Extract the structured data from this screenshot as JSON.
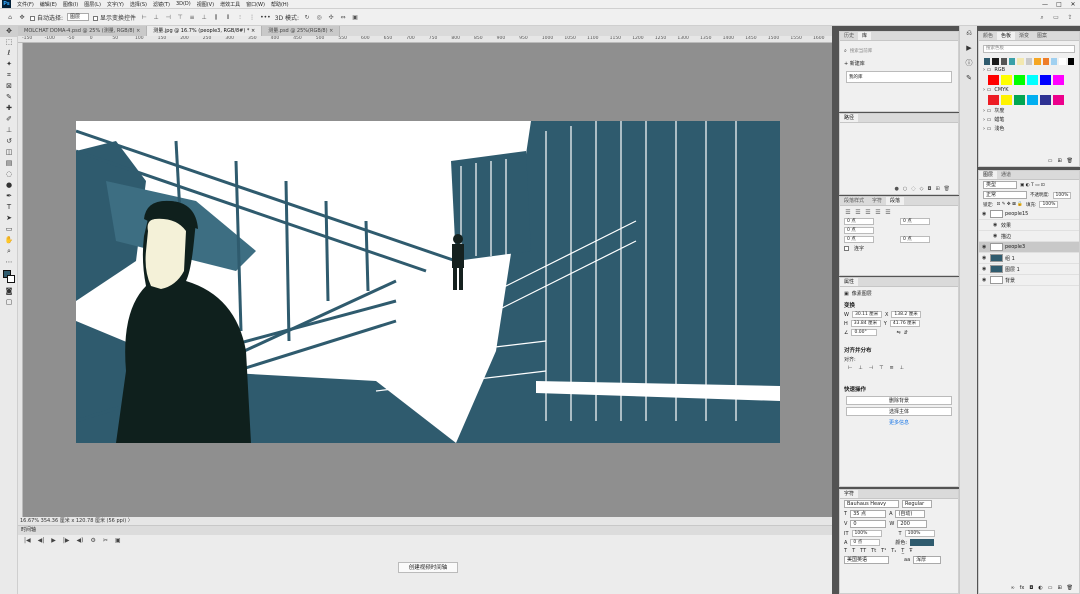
{
  "menubar": {
    "logo": "Ps",
    "items": [
      "文件(F)",
      "编辑(E)",
      "图像(I)",
      "图层(L)",
      "文字(Y)",
      "选择(S)",
      "滤镜(T)",
      "3D(D)",
      "视图(V)",
      "增效工具",
      "窗口(W)",
      "帮助(H)"
    ],
    "window_controls": [
      "—",
      "□",
      "✕"
    ]
  },
  "options_bar": {
    "auto_select_label": "自动选择:",
    "auto_select_value": "图层",
    "show_transform_label": "显示变换控件",
    "more": "•••",
    "mode_3d": "3D 模式:"
  },
  "tabs": [
    {
      "label": "MOLCHAT DOMA-4.psd @ 25% (测量, RGB/8) ×",
      "active": false
    },
    {
      "label": "测量.jpg @ 16.7% (people3, RGB/8#) * ×",
      "active": true
    },
    {
      "label": "测量.psd @ 25%(RGB/8) ×",
      "active": false
    }
  ],
  "ruler_ticks": [
    "-150",
    "-100",
    "-50",
    "0",
    "50",
    "100",
    "150",
    "200",
    "250",
    "300",
    "350",
    "400",
    "450",
    "500",
    "550",
    "600",
    "650",
    "700",
    "750",
    "800",
    "850",
    "900",
    "950",
    "1000",
    "1050",
    "1100",
    "1150",
    "1200",
    "1250",
    "1300",
    "1350",
    "1400",
    "1450",
    "1500",
    "1550",
    "1600"
  ],
  "status": "16.67%   354.36 厘米 x 120.78 厘米 (56 ppi)   〉",
  "timeline": {
    "title": "时间轴",
    "create_button": "创建视频时间轴",
    "controls": [
      "|◀",
      "◀|",
      "▶",
      "|▶",
      "◀)",
      "⚙",
      "✂",
      "▣"
    ]
  },
  "history_panel": {
    "tabs": [
      "历史",
      "库"
    ],
    "search_placeholder": "搜索当前库",
    "create_new": "+ 新建库",
    "library_item": "我的库"
  },
  "paths_panel": {
    "title": "路径"
  },
  "paragraph_panel": {
    "tabs": [
      "段落样式",
      "字符",
      "段落"
    ],
    "fields": [
      {
        "label": "缩进左",
        "value": "0 点"
      },
      {
        "label": "缩进右",
        "value": "0 点"
      },
      {
        "label": "首行缩进",
        "value": "0 点"
      },
      {
        "label": "段前",
        "value": "0 点"
      },
      {
        "label": "段后",
        "value": "0 点"
      }
    ],
    "hyphenate_label": "连字"
  },
  "properties_panel": {
    "title": "属性",
    "layer_type": "像素图层",
    "transform_title": "变换",
    "w_label": "W",
    "w_value": "30.11 厘米",
    "h_label": "H",
    "h_value": "33.84 厘米",
    "x_label": "X",
    "x_value": "138.2 厘米",
    "y_label": "Y",
    "y_value": "41.76 厘米",
    "angle_value": "0.00°",
    "align_title": "对齐并分布",
    "align_label": "对齐:",
    "quick_actions_title": "快速操作",
    "qa_buttons": [
      "删除背景",
      "选择主体"
    ],
    "more_link": "更多信息"
  },
  "character_panel": {
    "title": "字符",
    "font_family": "Bauhaus Heavy",
    "font_style": "Regular",
    "size": "35 点",
    "leading": "(自动)",
    "tracking": "0",
    "kerning": "200",
    "vscale": "100%",
    "hscale": "100%",
    "baseline": "0 点",
    "color_label": "颜色:",
    "color_value": "#2f5b6e",
    "language": "美国英语",
    "aa": "浑厚"
  },
  "swatches_panel": {
    "tabs": [
      "颜色",
      "色板",
      "渐变",
      "图案"
    ],
    "search_placeholder": "搜索色板",
    "recent": [
      "#2f5b6e",
      "#1a1a1a",
      "#555555",
      "#3aa0a8",
      "#f3e8b0",
      "#c9c9c9",
      "#f5a623",
      "#ee7d2a",
      "#a0d0f0",
      "#fff",
      "#000"
    ],
    "groups": [
      {
        "name": "RGB",
        "colors": [
          "#ff0000",
          "#ffff00",
          "#00ff00",
          "#00ffff",
          "#0000ff",
          "#ff00ff"
        ]
      },
      {
        "name": "CMYK",
        "colors": [
          "#ed1c24",
          "#fff200",
          "#00a651",
          "#00aeef",
          "#2e3192",
          "#ec008c"
        ]
      },
      {
        "name": "灰度",
        "colors": []
      },
      {
        "name": "蜡笔",
        "colors": []
      },
      {
        "name": "浅色",
        "colors": []
      }
    ]
  },
  "layers_panel": {
    "tabs": [
      "图层",
      "通道"
    ],
    "filter": "类型",
    "blend": "正常",
    "opacity_label": "不透明度:",
    "opacity": "100%",
    "lock_label": "锁定:",
    "fill_label": "填充:",
    "fill": "100%",
    "layers": [
      {
        "name": "people15",
        "sub": false,
        "selected": false
      },
      {
        "name": "效果",
        "sub": true,
        "selected": false
      },
      {
        "name": "描边",
        "sub": true,
        "selected": false
      },
      {
        "name": "people3",
        "sub": false,
        "selected": true
      },
      {
        "name": "组 1",
        "sub": false,
        "selected": false
      },
      {
        "name": "图层 1",
        "sub": false,
        "selected": false
      },
      {
        "name": "背景",
        "sub": false,
        "selected": false
      }
    ]
  }
}
